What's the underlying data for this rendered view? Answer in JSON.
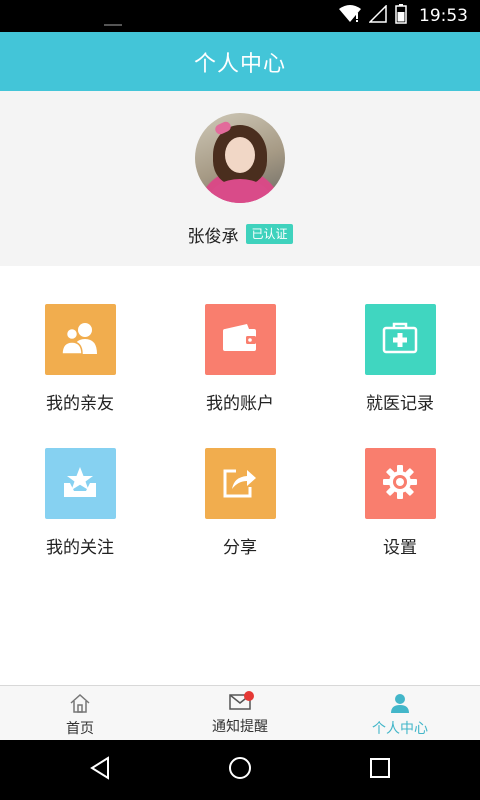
{
  "status_bar": {
    "time": "19:53",
    "icons": [
      "wifi-icon",
      "cell-signal-icon",
      "battery-icon"
    ]
  },
  "header": {
    "title": "个人中心"
  },
  "profile": {
    "name": "张俊承",
    "badge": "已认证"
  },
  "menu": [
    {
      "label": "我的亲友",
      "icon": "friends-icon",
      "color": "#f1ad4e"
    },
    {
      "label": "我的账户",
      "icon": "wallet-icon",
      "color": "#f97e6e"
    },
    {
      "label": "就医记录",
      "icon": "medical-kit-icon",
      "color": "#40d6c0"
    },
    {
      "label": "我的关注",
      "icon": "star-tray-icon",
      "color": "#86d1f1"
    },
    {
      "label": "分享",
      "icon": "share-icon",
      "color": "#f1ad4e"
    },
    {
      "label": "设置",
      "icon": "gear-icon",
      "color": "#f97e6e"
    }
  ],
  "bottom_nav": {
    "items": [
      {
        "label": "首页",
        "icon": "home-icon"
      },
      {
        "label": "通知提醒",
        "icon": "mail-icon"
      },
      {
        "label": "个人中心",
        "icon": "person-icon"
      }
    ],
    "active": "个人中心",
    "accent": "#43b6c9"
  },
  "system_nav": [
    "back-icon",
    "home-circle-icon",
    "recents-icon"
  ],
  "colors": {
    "header": "#43c5d8",
    "badge": "#3fd2bd",
    "notification_dot": "#e53935"
  }
}
